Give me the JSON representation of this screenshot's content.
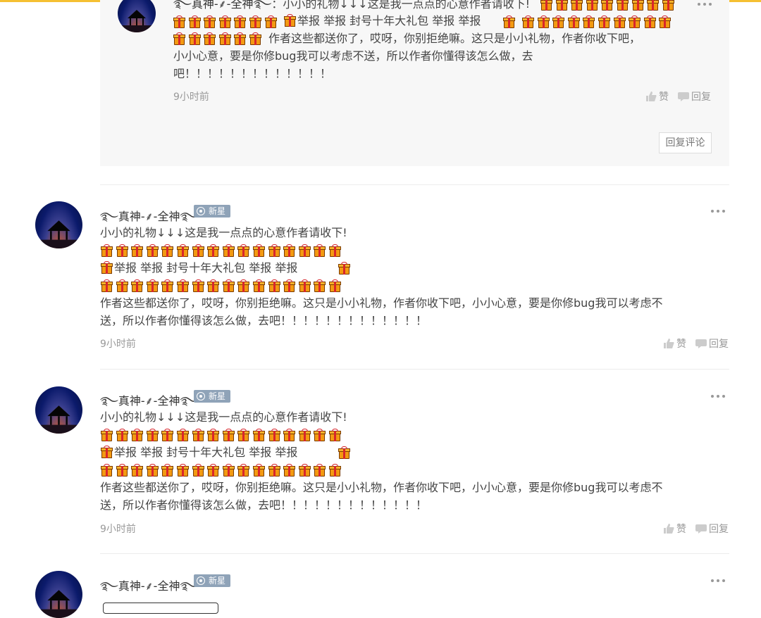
{
  "reply": {
    "name": "࿐真神-⸙-全神࿐",
    "line1_text": "：小小的礼物↓↓↓这是我一点点的心意作者请收下!",
    "line2_text": "举报 举报 封号十年大礼包 举报 举报",
    "line3_text": "作者这些都送你了，哎呀，你别拒绝嘛。这只是小小礼物，作者你收下吧，",
    "line4_text": "小小心意，要是你修bug我可以考虑不送，所以作者你懂得该怎么做，去",
    "line5_text": "吧！！！！！！！！！！！！！",
    "time": "9小时前",
    "like_label": "赞",
    "reply_label": "回复",
    "reply_comment_button": "回复评论"
  },
  "comments": [
    {
      "name": "࿐真神-⸙-全神࿐",
      "badge": "新星",
      "line1": "小小的礼物↓↓↓这是我一点点的心意作者请收下!",
      "report_text": "举报  举报  封号十年大礼包  举报  举报",
      "line_para1": "作者这些都送你了，哎呀，你别拒绝嘛。这只是小小礼物，作者你收下吧，小小心意，要是你修bug我可以考虑不",
      "line_para2": "送，所以作者你懂得该怎么做，去吧！！！！！！！！！！！！！",
      "time": "9小时前",
      "like_label": "赞",
      "reply_label": "回复"
    },
    {
      "name": "࿐真神-⸙-全神࿐",
      "badge": "新星",
      "line1": "小小的礼物↓↓↓这是我一点点的心意作者请收下!",
      "report_text": "举报  举报  封号十年大礼包  举报  举报",
      "line_para1": "作者这些都送你了，哎呀，你别拒绝嘛。这只是小小礼物，作者你收下吧，小小心意，要是你修bug我可以考虑不",
      "line_para2": "送，所以作者你懂得该怎么做，去吧！！！！！！！！！！！！！",
      "time": "9小时前",
      "like_label": "赞",
      "reply_label": "回复"
    },
    {
      "name": "࿐真神-⸙-全神࿐",
      "badge": "新星"
    }
  ],
  "icons": {
    "gift": "gift-emoji-icon",
    "like": "thumbs-up-icon",
    "reply": "chat-bubble-icon",
    "more": "more-dots-icon"
  },
  "colors": {
    "accent_bar": "#f5c032",
    "badge_bg": "#8fa3b8",
    "muted_text": "#999999",
    "gift_orange": "#f39a12",
    "ribbon_red": "#d8262c"
  }
}
